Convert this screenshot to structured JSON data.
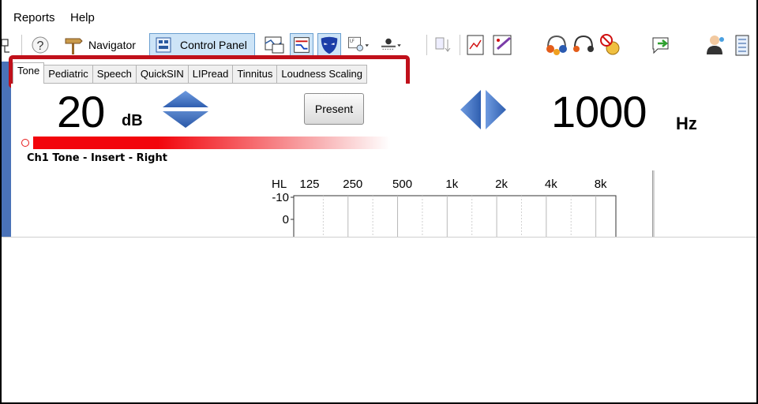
{
  "menu": {
    "items": [
      "Reports",
      "Help"
    ]
  },
  "toolbar": {
    "navigator_label": "Navigator",
    "control_panel_label": "Control Panel",
    "icons": [
      "tree-icon",
      "help-icon",
      "navigator-icon",
      "control-panel-icon",
      "image-view-icon",
      "audiogram-icon",
      "mask-icon",
      "zoom-dropdown-icon",
      "tool-dropdown-icon",
      "select-icon",
      "chart-icon",
      "edit-chart-icon",
      "headphones-icon",
      "headset-icon",
      "no-listen-icon",
      "export-icon",
      "user-icon",
      "panel-icon"
    ]
  },
  "tabs": [
    "Tone",
    "Pediatric",
    "Speech",
    "QuickSIN",
    "LIPread",
    "Tinnitus",
    "Loudness Scaling"
  ],
  "active_tab": "Tone",
  "control": {
    "level_value": "20",
    "level_unit": "dB",
    "present_label": "Present",
    "freq_value": "1000",
    "freq_unit": "Hz",
    "level_fill_fraction": 0.35,
    "channel_label": "Ch1  Tone - Insert - Right"
  },
  "audiogram": {
    "y_axis_label": "HL",
    "freq_labels": [
      "125",
      "250",
      "500",
      "1k",
      "2k",
      "4k",
      "8k"
    ],
    "hl_labels": [
      "-10",
      "0"
    ]
  },
  "colors": {
    "accent_blue": "#4a72b8",
    "highlight_red": "#c0101a",
    "level_red": "#f2050c",
    "arrow_blue": "#4a7ac8"
  }
}
